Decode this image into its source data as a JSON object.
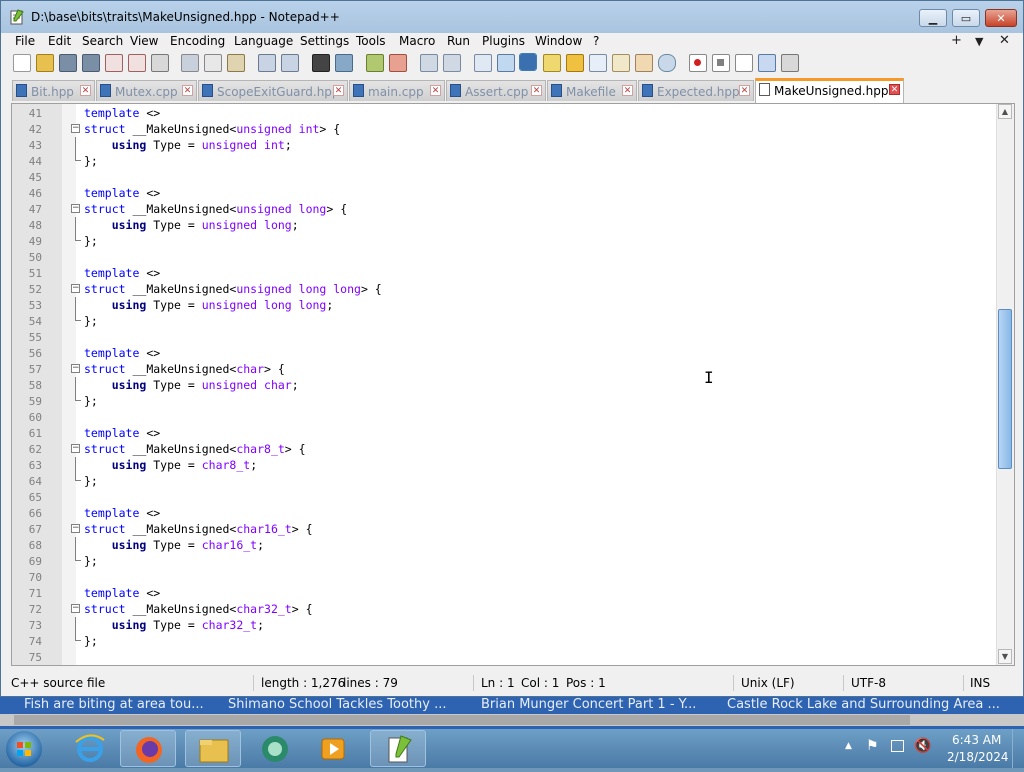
{
  "window": {
    "title": "D:\\base\\bits\\traits\\MakeUnsigned.hpp - Notepad++"
  },
  "menu": [
    "File",
    "Edit",
    "Search",
    "View",
    "Encoding",
    "Language",
    "Settings",
    "Tools",
    "Macro",
    "Run",
    "Plugins",
    "Window",
    "?"
  ],
  "menu_right": {
    "add": "+",
    "dropdown": "▼",
    "close": "✕"
  },
  "tabs": [
    "Bit.hpp",
    "Mutex.cpp",
    "ScopeExitGuard.hpp",
    "main.cpp",
    "Assert.cpp",
    "Makefile",
    "Expected.hpp",
    "MakeUnsigned.hpp"
  ],
  "active_tab": "MakeUnsigned.hpp",
  "editor": {
    "lines": [
      {
        "n": "41",
        "parts": [
          [
            "kw",
            "template"
          ],
          [
            "p",
            " <>"
          ]
        ]
      },
      {
        "n": "42",
        "fold": "open",
        "parts": [
          [
            "kw",
            "struct"
          ],
          [
            "p",
            " __MakeUnsigned<"
          ],
          [
            "ty",
            "unsigned int"
          ],
          [
            "p",
            "> {"
          ]
        ]
      },
      {
        "n": "43",
        "parts": [
          [
            "p",
            "    "
          ],
          [
            "kwb",
            "using"
          ],
          [
            "p",
            " Type = "
          ],
          [
            "ty",
            "unsigned int"
          ],
          [
            "p",
            ";"
          ]
        ]
      },
      {
        "n": "44",
        "fold": "end",
        "parts": [
          [
            "p",
            "};"
          ]
        ]
      },
      {
        "n": "45",
        "parts": []
      },
      {
        "n": "46",
        "parts": [
          [
            "kw",
            "template"
          ],
          [
            "p",
            " <>"
          ]
        ]
      },
      {
        "n": "47",
        "fold": "open",
        "parts": [
          [
            "kw",
            "struct"
          ],
          [
            "p",
            " __MakeUnsigned<"
          ],
          [
            "ty",
            "unsigned long"
          ],
          [
            "p",
            "> {"
          ]
        ]
      },
      {
        "n": "48",
        "parts": [
          [
            "p",
            "    "
          ],
          [
            "kwb",
            "using"
          ],
          [
            "p",
            " Type = "
          ],
          [
            "ty",
            "unsigned long"
          ],
          [
            "p",
            ";"
          ]
        ]
      },
      {
        "n": "49",
        "fold": "end",
        "parts": [
          [
            "p",
            "};"
          ]
        ]
      },
      {
        "n": "50",
        "parts": []
      },
      {
        "n": "51",
        "parts": [
          [
            "kw",
            "template"
          ],
          [
            "p",
            " <>"
          ]
        ]
      },
      {
        "n": "52",
        "fold": "open",
        "parts": [
          [
            "kw",
            "struct"
          ],
          [
            "p",
            " __MakeUnsigned<"
          ],
          [
            "ty",
            "unsigned long long"
          ],
          [
            "p",
            "> {"
          ]
        ]
      },
      {
        "n": "53",
        "parts": [
          [
            "p",
            "    "
          ],
          [
            "kwb",
            "using"
          ],
          [
            "p",
            " Type = "
          ],
          [
            "ty",
            "unsigned long long"
          ],
          [
            "p",
            ";"
          ]
        ]
      },
      {
        "n": "54",
        "fold": "end",
        "parts": [
          [
            "p",
            "};"
          ]
        ]
      },
      {
        "n": "55",
        "parts": []
      },
      {
        "n": "56",
        "parts": [
          [
            "kw",
            "template"
          ],
          [
            "p",
            " <>"
          ]
        ]
      },
      {
        "n": "57",
        "fold": "open",
        "parts": [
          [
            "kw",
            "struct"
          ],
          [
            "p",
            " __MakeUnsigned<"
          ],
          [
            "ty",
            "char"
          ],
          [
            "p",
            "> {"
          ]
        ]
      },
      {
        "n": "58",
        "parts": [
          [
            "p",
            "    "
          ],
          [
            "kwb",
            "using"
          ],
          [
            "p",
            " Type = "
          ],
          [
            "ty",
            "unsigned char"
          ],
          [
            "p",
            ";"
          ]
        ]
      },
      {
        "n": "59",
        "fold": "end",
        "parts": [
          [
            "p",
            "};"
          ]
        ]
      },
      {
        "n": "60",
        "parts": []
      },
      {
        "n": "61",
        "parts": [
          [
            "kw",
            "template"
          ],
          [
            "p",
            " <>"
          ]
        ]
      },
      {
        "n": "62",
        "fold": "open",
        "parts": [
          [
            "kw",
            "struct"
          ],
          [
            "p",
            " __MakeUnsigned<"
          ],
          [
            "ty",
            "char8_t"
          ],
          [
            "p",
            "> {"
          ]
        ]
      },
      {
        "n": "63",
        "parts": [
          [
            "p",
            "    "
          ],
          [
            "kwb",
            "using"
          ],
          [
            "p",
            " Type = "
          ],
          [
            "ty",
            "char8_t"
          ],
          [
            "p",
            ";"
          ]
        ]
      },
      {
        "n": "64",
        "fold": "end",
        "parts": [
          [
            "p",
            "};"
          ]
        ]
      },
      {
        "n": "65",
        "parts": []
      },
      {
        "n": "66",
        "parts": [
          [
            "kw",
            "template"
          ],
          [
            "p",
            " <>"
          ]
        ]
      },
      {
        "n": "67",
        "fold": "open",
        "parts": [
          [
            "kw",
            "struct"
          ],
          [
            "p",
            " __MakeUnsigned<"
          ],
          [
            "ty",
            "char16_t"
          ],
          [
            "p",
            "> {"
          ]
        ]
      },
      {
        "n": "68",
        "parts": [
          [
            "p",
            "    "
          ],
          [
            "kwb",
            "using"
          ],
          [
            "p",
            " Type = "
          ],
          [
            "ty",
            "char16_t"
          ],
          [
            "p",
            ";"
          ]
        ]
      },
      {
        "n": "69",
        "fold": "end",
        "parts": [
          [
            "p",
            "};"
          ]
        ]
      },
      {
        "n": "70",
        "parts": []
      },
      {
        "n": "71",
        "parts": [
          [
            "kw",
            "template"
          ],
          [
            "p",
            " <>"
          ]
        ]
      },
      {
        "n": "72",
        "fold": "open",
        "parts": [
          [
            "kw",
            "struct"
          ],
          [
            "p",
            " __MakeUnsigned<"
          ],
          [
            "ty",
            "char32_t"
          ],
          [
            "p",
            "> {"
          ]
        ]
      },
      {
        "n": "73",
        "parts": [
          [
            "p",
            "    "
          ],
          [
            "kwb",
            "using"
          ],
          [
            "p",
            " Type = "
          ],
          [
            "ty",
            "char32_t"
          ],
          [
            "p",
            ";"
          ]
        ]
      },
      {
        "n": "74",
        "fold": "end",
        "parts": [
          [
            "p",
            "};"
          ]
        ]
      },
      {
        "n": "75",
        "parts": []
      }
    ]
  },
  "status": {
    "filetype": "C++ source file",
    "length": "length : 1,276",
    "lines": "lines : 79",
    "ln": "Ln : 1",
    "col": "Col : 1",
    "pos": "Pos : 1",
    "eol": "Unix (LF)",
    "encoding": "UTF-8",
    "mode": "INS"
  },
  "ticker": [
    "Fish are biting at area tou...",
    "Shimano School Tackles Toothy ...",
    "Brian Munger Concert Part 1 - Y...",
    "Castle Rock Lake and Surrounding Area ..."
  ],
  "taskbar": {
    "apps": [
      "start-orb",
      "internet-explorer-icon",
      "firefox-icon",
      "file-explorer-icon",
      "media-center-icon",
      "media-player-icon",
      "notepadpp-icon"
    ],
    "time": "6:43 AM",
    "date": "2/18/2024"
  },
  "colors": {
    "accent_tab": "#f59a2a",
    "keyword": "#0000ff",
    "type": "#8000ff",
    "taskbar": "#4a7aa6"
  }
}
